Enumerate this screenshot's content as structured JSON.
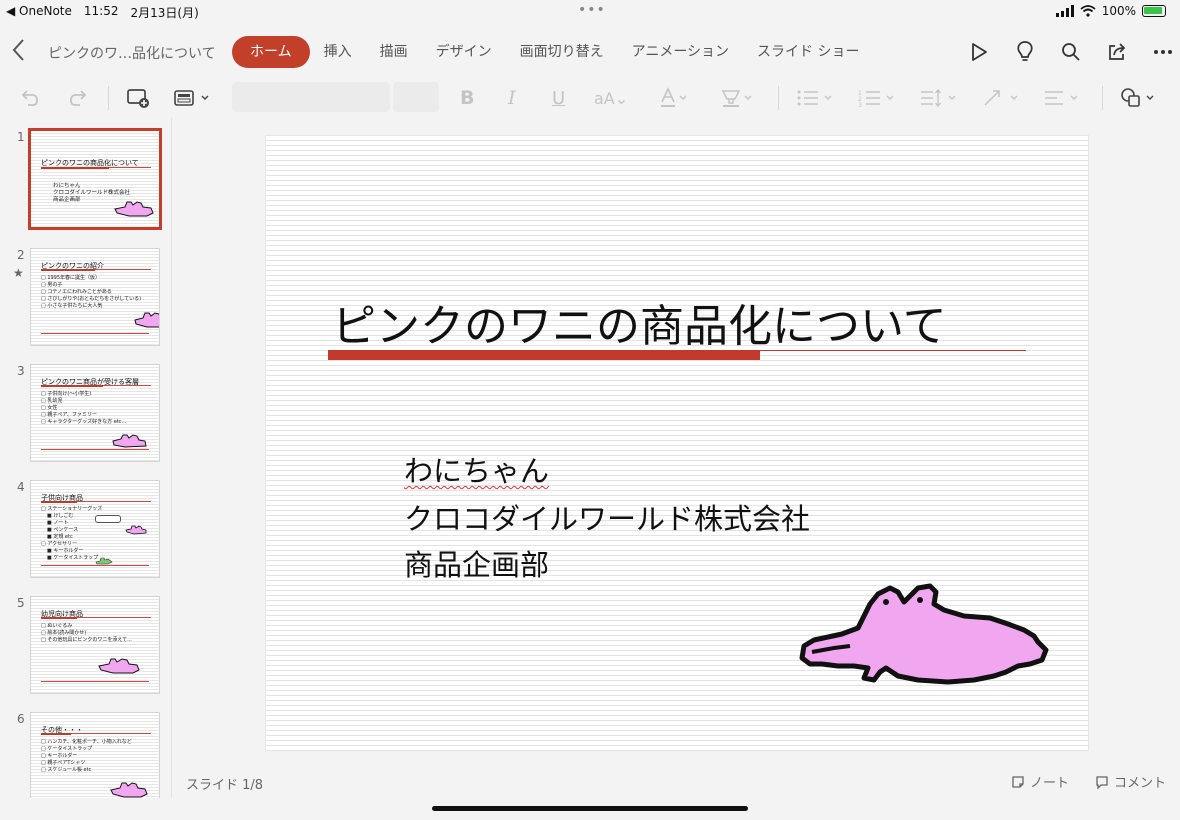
{
  "status": {
    "back_app": "◀ OneNote",
    "time": "11:52",
    "date": "2月13日(月)",
    "battery": "100%"
  },
  "document": {
    "title": "ピンクのワ…品化について"
  },
  "tabs": [
    {
      "label": "ホーム",
      "active": true
    },
    {
      "label": "挿入"
    },
    {
      "label": "描画"
    },
    {
      "label": "デザイン"
    },
    {
      "label": "画面切り替え"
    },
    {
      "label": "アニメーション"
    },
    {
      "label": "スライド ショー"
    }
  ],
  "top_icons": [
    "play-icon",
    "lightbulb-icon",
    "search-icon",
    "share-icon",
    "more-icon"
  ],
  "ribbon_icons": [
    "undo-icon",
    "redo-icon",
    "new-slide-icon",
    "layout-icon",
    "bold-icon",
    "italic-icon",
    "underline-icon",
    "font-size-icon",
    "font-color-icon",
    "highlight-icon",
    "bullets-icon",
    "numbering-icon",
    "line-spacing-icon",
    "text-direction-icon",
    "align-icon",
    "shapes-icon"
  ],
  "thumbnails": [
    {
      "num": "1",
      "title": "ピンクのワニの商品化について",
      "subtitle": [
        "わにちゃん",
        "クロコダイルワールド株式会社",
        "商品企画部"
      ],
      "selected": true
    },
    {
      "num": "2",
      "title": "ピンクのワニの紹介",
      "star": "★",
      "bullets": [
        "1995年春に誕生（仮）",
        "男の子",
        "コテノエにわれみことがある",
        "さびしがりや(おともだちをさがしている)",
        "小さな子供たちに大人気"
      ]
    },
    {
      "num": "3",
      "title": "ピンクのワニ商品が受ける客層",
      "bullets": [
        "子供向け(〜小学生)",
        "乳幼児",
        "女性",
        "親子ペア、ファミリー",
        "キャラクターグッズ好きな方 etc..."
      ]
    },
    {
      "num": "4",
      "title": "子供向け商品",
      "bullets": [
        "ステーショナリーグッズ",
        "けしごむ",
        "ノート",
        "ペンケース",
        "定規 etc",
        "アクセサリー",
        "キーホルダー",
        "ケータイストラップ"
      ]
    },
    {
      "num": "5",
      "title": "幼児向け商品",
      "bullets": [
        "ぬいぐるみ",
        "絵本(読み聞かせ)",
        "その他玩具にピンクのワニを添えて..."
      ]
    },
    {
      "num": "6",
      "title": "その他・・・",
      "bullets": [
        "ハンカチ、化粧ポーチ、小物入れなど",
        "ケータイストラップ",
        "キーホルダー",
        "親子ペアTシャツ",
        "スケジュール帳 etc"
      ]
    }
  ],
  "slide": {
    "title": "ピンクのワニの商品化について",
    "subtitle": [
      "わにちゃん",
      "クロコダイルワールド株式会社",
      "商品企画部"
    ]
  },
  "footer": {
    "slide_counter": "スライド 1/8",
    "notes": "ノート",
    "comments": "コメント"
  },
  "colors": {
    "accent": "#c2402a",
    "title_bar": "#c2392b",
    "croc_fill": "#f1a7f0",
    "croc_outline": "#111111"
  }
}
